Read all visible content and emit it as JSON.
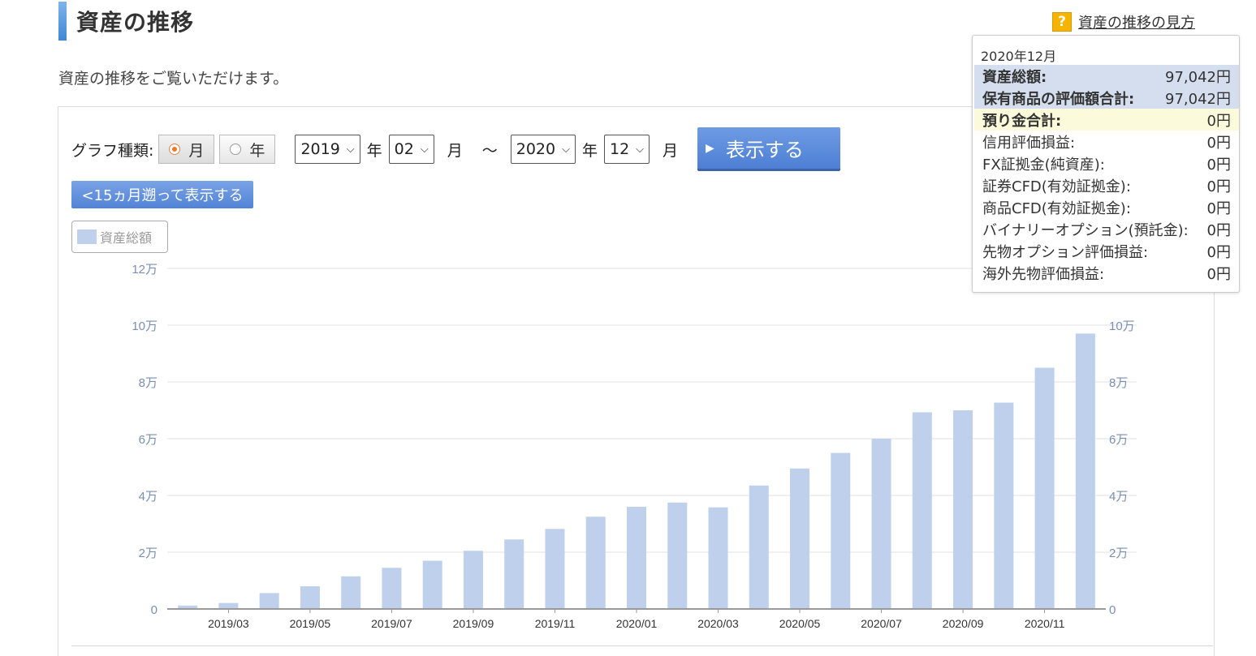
{
  "header": {
    "title": "資産の推移",
    "help_icon": "question-icon",
    "help_glyph": "?",
    "help_text": "資産の推移の見方",
    "description": "資産の推移をご覧いただけます。"
  },
  "controls": {
    "graph_type_label": "グラフ種類:",
    "options": [
      {
        "label": "月",
        "selected": true
      },
      {
        "label": "年",
        "selected": false
      }
    ],
    "from_year": "2019",
    "from_month": "02",
    "to_year": "2020",
    "to_month": "12",
    "year_unit": "年",
    "month_unit": "月",
    "tilde": "〜",
    "show_button": "表示する",
    "back_button": "<15ヵ月遡って表示する"
  },
  "legend": {
    "label": "資産総額"
  },
  "colors": {
    "bar": "#bfd0ec",
    "accent": "#4e7fd4",
    "tick": "#7a8fb0"
  },
  "chart_data": {
    "type": "bar",
    "categories": [
      "2019/02",
      "2019/03",
      "2019/04",
      "2019/05",
      "2019/06",
      "2019/07",
      "2019/08",
      "2019/09",
      "2019/10",
      "2019/11",
      "2019/12",
      "2020/01",
      "2020/02",
      "2020/03",
      "2020/04",
      "2020/05",
      "2020/06",
      "2020/07",
      "2020/08",
      "2020/09",
      "2020/10",
      "2020/11",
      "2020/12"
    ],
    "x_tick_labels": [
      "2019/03",
      "2019/05",
      "2019/07",
      "2019/09",
      "2019/11",
      "2020/01",
      "2020/03",
      "2020/05",
      "2020/07",
      "2020/09",
      "2020/11"
    ],
    "series": [
      {
        "values": [
          1200,
          2100,
          5600,
          8000,
          11500,
          14500,
          17000,
          20500,
          24500,
          28200,
          32500,
          36000,
          37500,
          35800,
          43500,
          49500,
          55000,
          60000,
          69300,
          70000,
          72700,
          85000,
          97042
        ]
      }
    ],
    "ylim": [
      0,
      120000
    ],
    "yticks": [
      0,
      20000,
      40000,
      60000,
      80000,
      100000,
      120000
    ],
    "ytick_labels": [
      "0",
      "2万",
      "4万",
      "6万",
      "8万",
      "10万",
      "12万"
    ],
    "right_ytick_labels": [
      "0",
      "2万",
      "4万",
      "6万",
      "8万",
      "10万"
    ],
    "grid": true
  },
  "tooltip": {
    "month": "2020年12月",
    "rows": [
      {
        "label": "資産総額:",
        "value": "97,042円",
        "style": "blue"
      },
      {
        "label": "保有商品の評価額合計:",
        "value": "97,042円",
        "style": "blue"
      },
      {
        "label": "預り金合計:",
        "value": "0円",
        "style": "yellow"
      },
      {
        "label": "信用評価損益:",
        "value": "0円",
        "style": ""
      },
      {
        "label": "FX証拠金(純資産):",
        "value": "0円",
        "style": ""
      },
      {
        "label": "証券CFD(有効証拠金):",
        "value": "0円",
        "style": ""
      },
      {
        "label": "商品CFD(有効証拠金):",
        "value": "0円",
        "style": ""
      },
      {
        "label": "バイナリーオプション(預託金):",
        "value": "0円",
        "style": ""
      },
      {
        "label": "先物オプション評価損益:",
        "value": "0円",
        "style": ""
      },
      {
        "label": "海外先物評価損益:",
        "value": "0円",
        "style": ""
      }
    ]
  }
}
